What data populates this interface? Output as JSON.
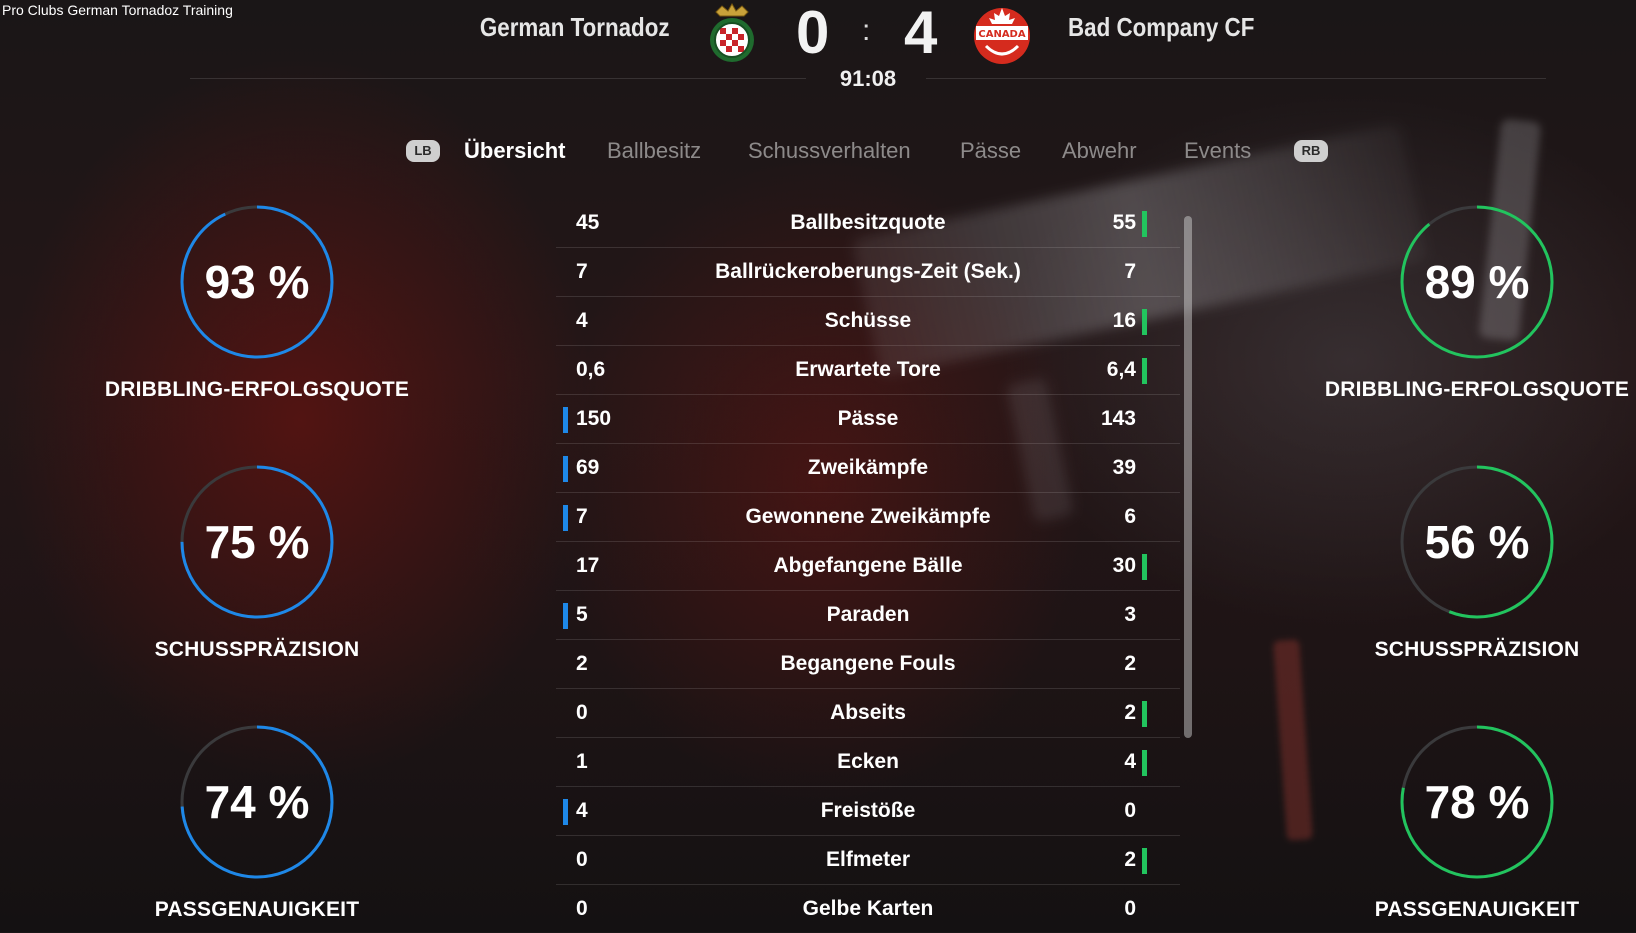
{
  "app_title": "Pro Clubs German Tornadoz Training",
  "match": {
    "home_team": "German Tornadoz",
    "away_team": "Bad Company CF",
    "home_score": "0",
    "away_score": "4",
    "separator": ":",
    "time": "91:08",
    "away_crest_text": "CANADA"
  },
  "tabs": {
    "left_shoulder": "LB",
    "right_shoulder": "RB",
    "items": [
      {
        "label": "Übersicht",
        "active": true
      },
      {
        "label": "Ballbesitz",
        "active": false
      },
      {
        "label": "Schussverhalten",
        "active": false
      },
      {
        "label": "Pässe",
        "active": false
      },
      {
        "label": "Abwehr",
        "active": false
      },
      {
        "label": "Events",
        "active": false
      }
    ]
  },
  "home_rings": [
    {
      "value": "93 %",
      "label": "DRIBBLING-ERFOLGSQUOTE",
      "fraction": 0.93
    },
    {
      "value": "75 %",
      "label": "SCHUSSPRÄZISION",
      "fraction": 0.75
    },
    {
      "value": "74 %",
      "label": "PASSGENAUIGKEIT",
      "fraction": 0.74
    }
  ],
  "away_rings": [
    {
      "value": "89 %",
      "label": "DRIBBLING-ERFOLGSQUOTE",
      "fraction": 0.89
    },
    {
      "value": "56 %",
      "label": "SCHUSSPRÄZISION",
      "fraction": 0.56
    },
    {
      "value": "78 %",
      "label": "PASSGENAUIGKEIT",
      "fraction": 0.78
    }
  ],
  "stats": [
    {
      "label": "Ballbesitzquote",
      "home": "45",
      "away": "55",
      "leader": "away"
    },
    {
      "label": "Ballrückeroberungs-Zeit (Sek.)",
      "home": "7",
      "away": "7",
      "leader": "none"
    },
    {
      "label": "Schüsse",
      "home": "4",
      "away": "16",
      "leader": "away"
    },
    {
      "label": "Erwartete Tore",
      "home": "0,6",
      "away": "6,4",
      "leader": "away"
    },
    {
      "label": "Pässe",
      "home": "150",
      "away": "143",
      "leader": "home"
    },
    {
      "label": "Zweikämpfe",
      "home": "69",
      "away": "39",
      "leader": "home"
    },
    {
      "label": "Gewonnene Zweikämpfe",
      "home": "7",
      "away": "6",
      "leader": "home"
    },
    {
      "label": "Abgefangene Bälle",
      "home": "17",
      "away": "30",
      "leader": "away"
    },
    {
      "label": "Paraden",
      "home": "5",
      "away": "3",
      "leader": "home"
    },
    {
      "label": "Begangene Fouls",
      "home": "2",
      "away": "2",
      "leader": "none"
    },
    {
      "label": "Abseits",
      "home": "0",
      "away": "2",
      "leader": "away"
    },
    {
      "label": "Ecken",
      "home": "1",
      "away": "4",
      "leader": "away"
    },
    {
      "label": "Freistöße",
      "home": "4",
      "away": "0",
      "leader": "home"
    },
    {
      "label": "Elfmeter",
      "home": "0",
      "away": "2",
      "leader": "away"
    },
    {
      "label": "Gelbe Karten",
      "home": "0",
      "away": "0",
      "leader": "none"
    }
  ],
  "colors": {
    "home_accent": "#1e88e8",
    "away_accent": "#22c45e",
    "ring_track": "#3a3a3c"
  }
}
